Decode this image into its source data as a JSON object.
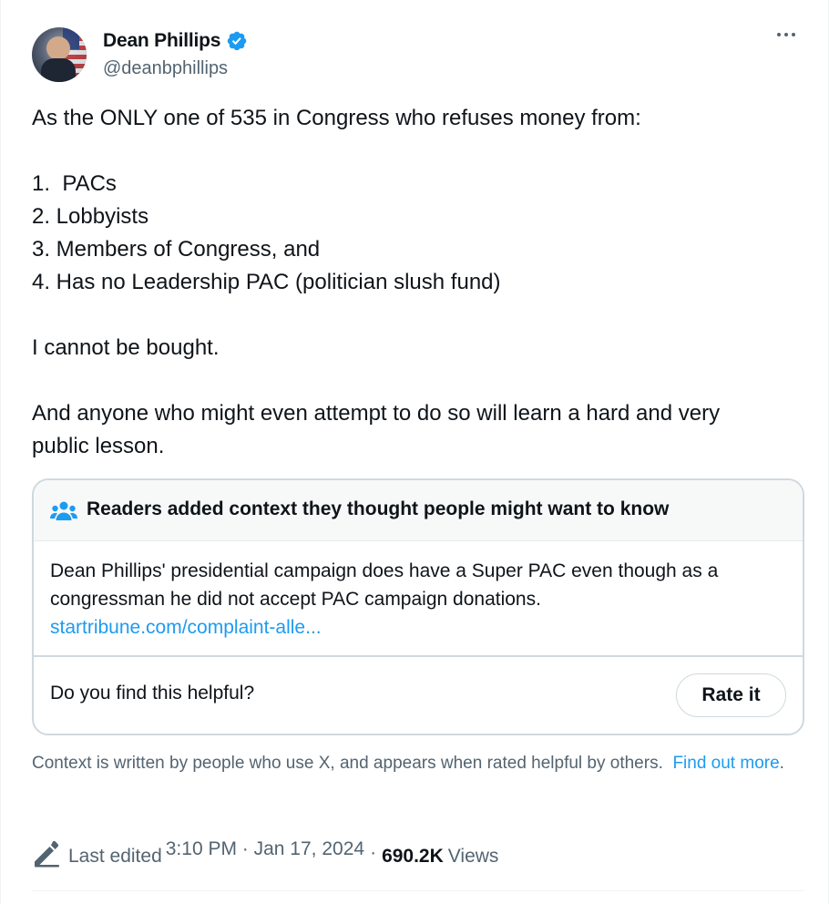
{
  "author": {
    "display_name": "Dean Phillips",
    "handle": "@deanbphillips",
    "verified": true
  },
  "tweet": {
    "lines": [
      "As the ONLY one of 535 in Congress who refuses money from:",
      "",
      "1.  PACs",
      "2. Lobbyists",
      "3. Members of Congress, and",
      "4. Has no Leadership PAC (politician slush fund)",
      "",
      "I cannot be bought.",
      "",
      "And anyone who might even attempt to do so will learn a hard and very",
      "public lesson."
    ]
  },
  "community_note": {
    "title": "Readers added context they thought people might want to know",
    "body_line1": "Dean Phillips' presidential campaign does have a Super PAC even though as a",
    "body_line2": "congressman he did not accept PAC campaign donations.",
    "link_text": "startribune.com/complaint-alle...",
    "helpful_question": "Do you find this helpful?",
    "rate_button": "Rate it"
  },
  "context_footer": {
    "text": "Context is written by people who use X, and appears when rated helpful by others.",
    "link_text": "Find out more",
    "trailing": "."
  },
  "meta": {
    "edited_label": "Last edited",
    "timestamp": "3:10 PM · Jan 17, 2024",
    "separator": "·",
    "views_count": "690.2K",
    "views_label": "Views"
  },
  "colors": {
    "accent": "#1d9bf0",
    "secondary_text": "#536471",
    "primary_text": "#0f1419",
    "border": "#cfd9de"
  },
  "icons": {
    "verified": "verified-badge-icon",
    "more": "more-options-icon",
    "note": "people-icon",
    "edited": "pencil-icon"
  }
}
